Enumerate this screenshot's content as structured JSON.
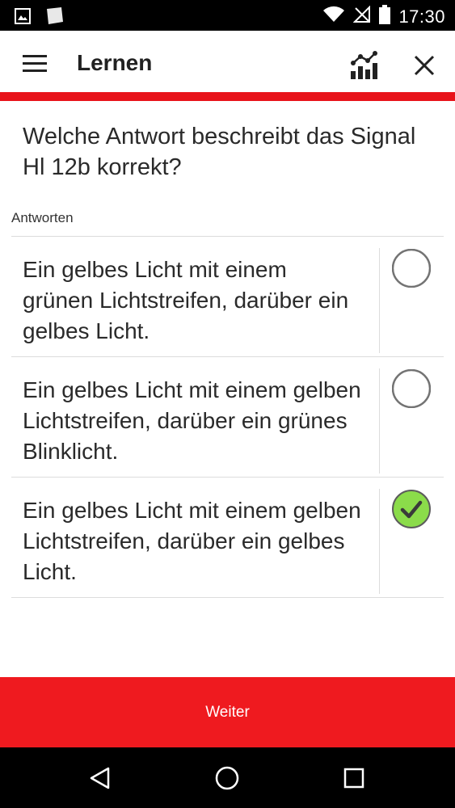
{
  "status_bar": {
    "time": "17:30",
    "icons": [
      "image-icon",
      "note-icon",
      "wifi-icon",
      "no-signal-icon",
      "battery-icon"
    ]
  },
  "app_bar": {
    "title": "Lernen",
    "icons": [
      "menu-icon",
      "statistics-icon",
      "close-icon"
    ]
  },
  "question": {
    "text": "Welche Antwort beschreibt das Signal Hl 12b korrekt?"
  },
  "answers_section": {
    "label": "Antworten",
    "items": [
      {
        "text": "Ein gelbes Licht mit einem grünen Lichtstreifen, darüber ein gelbes Licht.",
        "selected": false
      },
      {
        "text": "Ein gelbes Licht mit einem gelben Lichtstreifen, darüber ein grünes Blinklicht.",
        "selected": false
      },
      {
        "text": "Ein gelbes Licht mit einem gelben Lichtstreifen, darüber ein gelbes Licht.",
        "selected": true
      }
    ]
  },
  "footer": {
    "next_label": "Weiter"
  },
  "nav_bar": {
    "icons": [
      "back-icon",
      "home-icon",
      "recents-icon"
    ]
  },
  "colors": {
    "accent_red": "#ef1a1f",
    "check_green": "#8bdc4a"
  }
}
